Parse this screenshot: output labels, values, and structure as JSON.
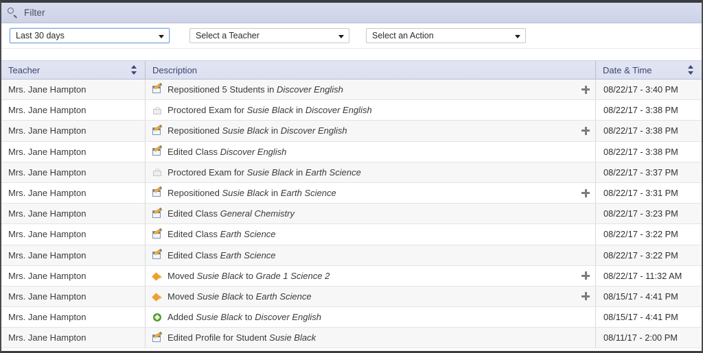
{
  "filter": {
    "icon": "search-icon",
    "label": "Filter"
  },
  "selectors": [
    {
      "name": "date-range",
      "value": "Last 30 days",
      "focused": true
    },
    {
      "name": "teacher",
      "value": "Select a Teacher",
      "focused": false
    },
    {
      "name": "action",
      "value": "Select an Action",
      "focused": false
    }
  ],
  "table": {
    "columns": [
      {
        "key": "teacher",
        "label": "Teacher",
        "sortable": true
      },
      {
        "key": "description",
        "label": "Description",
        "sortable": false
      },
      {
        "key": "datetime",
        "label": "Date & Time",
        "sortable": true
      }
    ],
    "rows": [
      {
        "teacher": "Mrs. Jane Hampton",
        "icon": "edit-icon",
        "parts": [
          {
            "t": "Repositioned 5 Students in ",
            "i": false
          },
          {
            "t": "Discover English",
            "i": true
          }
        ],
        "expandable": true,
        "datetime": "08/22/17 - 3:40 PM"
      },
      {
        "teacher": "Mrs. Jane Hampton",
        "icon": "exam-icon",
        "parts": [
          {
            "t": "Proctored Exam for ",
            "i": false
          },
          {
            "t": "Susie Black",
            "i": true
          },
          {
            "t": " in ",
            "i": false
          },
          {
            "t": "Discover English",
            "i": true
          }
        ],
        "expandable": false,
        "datetime": "08/22/17 - 3:38 PM"
      },
      {
        "teacher": "Mrs. Jane Hampton",
        "icon": "edit-icon",
        "parts": [
          {
            "t": "Repositioned ",
            "i": false
          },
          {
            "t": "Susie Black",
            "i": true
          },
          {
            "t": " in ",
            "i": false
          },
          {
            "t": "Discover English",
            "i": true
          }
        ],
        "expandable": true,
        "datetime": "08/22/17 - 3:38 PM"
      },
      {
        "teacher": "Mrs. Jane Hampton",
        "icon": "edit-icon",
        "parts": [
          {
            "t": "Edited Class ",
            "i": false
          },
          {
            "t": "Discover English",
            "i": true
          }
        ],
        "expandable": false,
        "datetime": "08/22/17 - 3:38 PM"
      },
      {
        "teacher": "Mrs. Jane Hampton",
        "icon": "exam-icon",
        "parts": [
          {
            "t": "Proctored Exam for ",
            "i": false
          },
          {
            "t": "Susie Black",
            "i": true
          },
          {
            "t": " in ",
            "i": false
          },
          {
            "t": "Earth Science",
            "i": true
          }
        ],
        "expandable": false,
        "datetime": "08/22/17 - 3:37 PM"
      },
      {
        "teacher": "Mrs. Jane Hampton",
        "icon": "edit-icon",
        "parts": [
          {
            "t": "Repositioned ",
            "i": false
          },
          {
            "t": "Susie Black",
            "i": true
          },
          {
            "t": " in ",
            "i": false
          },
          {
            "t": "Earth Science",
            "i": true
          }
        ],
        "expandable": true,
        "datetime": "08/22/17 - 3:31 PM"
      },
      {
        "teacher": "Mrs. Jane Hampton",
        "icon": "edit-icon",
        "parts": [
          {
            "t": "Edited Class ",
            "i": false
          },
          {
            "t": "General Chemistry",
            "i": true
          }
        ],
        "expandable": false,
        "datetime": "08/22/17 - 3:23 PM"
      },
      {
        "teacher": "Mrs. Jane Hampton",
        "icon": "edit-icon",
        "parts": [
          {
            "t": "Edited Class ",
            "i": false
          },
          {
            "t": "Earth Science",
            "i": true
          }
        ],
        "expandable": false,
        "datetime": "08/22/17 - 3:22 PM"
      },
      {
        "teacher": "Mrs. Jane Hampton",
        "icon": "edit-icon",
        "parts": [
          {
            "t": "Edited Class ",
            "i": false
          },
          {
            "t": "Earth Science",
            "i": true
          }
        ],
        "expandable": false,
        "datetime": "08/22/17 - 3:22 PM"
      },
      {
        "teacher": "Mrs. Jane Hampton",
        "icon": "moved-icon",
        "parts": [
          {
            "t": "Moved ",
            "i": false
          },
          {
            "t": "Susie Black",
            "i": true
          },
          {
            "t": " to ",
            "i": false
          },
          {
            "t": "Grade 1 Science 2",
            "i": true
          }
        ],
        "expandable": true,
        "datetime": "08/22/17 - 11:32 AM"
      },
      {
        "teacher": "Mrs. Jane Hampton",
        "icon": "moved-icon",
        "parts": [
          {
            "t": "Moved ",
            "i": false
          },
          {
            "t": "Susie Black",
            "i": true
          },
          {
            "t": " to ",
            "i": false
          },
          {
            "t": "Earth Science",
            "i": true
          }
        ],
        "expandable": true,
        "datetime": "08/15/17 - 4:41 PM"
      },
      {
        "teacher": "Mrs. Jane Hampton",
        "icon": "added-icon",
        "parts": [
          {
            "t": "Added ",
            "i": false
          },
          {
            "t": "Susie Black",
            "i": true
          },
          {
            "t": " to ",
            "i": false
          },
          {
            "t": "Discover English",
            "i": true
          }
        ],
        "expandable": false,
        "datetime": "08/15/17 - 4:41 PM"
      },
      {
        "teacher": "Mrs. Jane Hampton",
        "icon": "edit-icon",
        "parts": [
          {
            "t": "Edited Profile for Student ",
            "i": false
          },
          {
            "t": "Susie Black",
            "i": true
          }
        ],
        "expandable": false,
        "datetime": "08/11/17 - 2:00 PM"
      }
    ]
  },
  "colors": {
    "header_text": "#3d4573",
    "header_bg": "#dfe3f1",
    "filter_bg": "#d5d9ea",
    "row_alt": "#f7f7f8",
    "focus_border": "#7aa7e0",
    "icon_added": "#4e9c2e",
    "icon_moved": "#f0a030"
  }
}
